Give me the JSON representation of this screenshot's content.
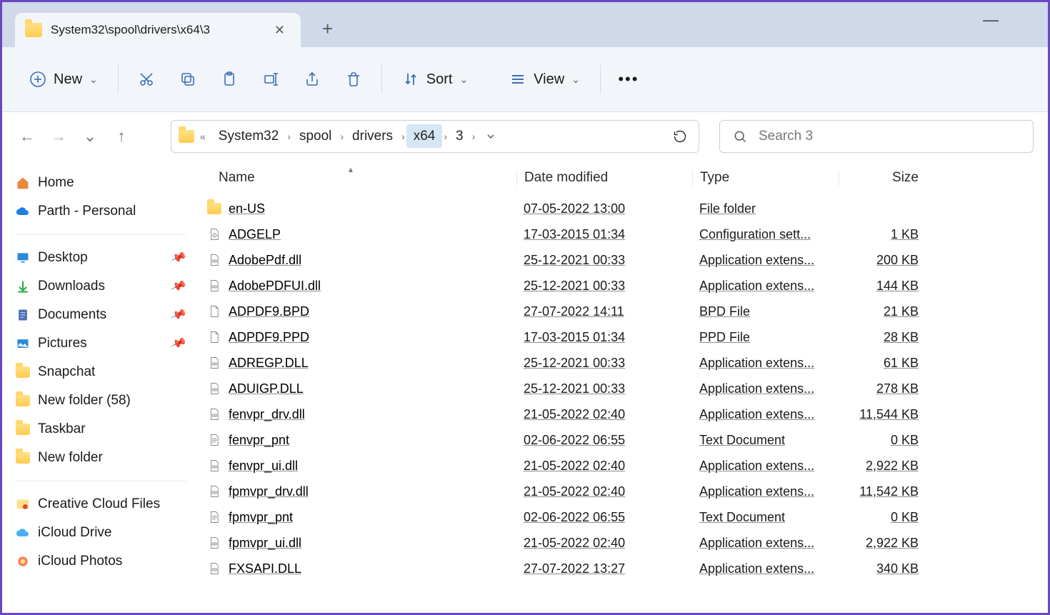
{
  "window": {
    "tab_title": "System32\\spool\\drivers\\x64\\3"
  },
  "toolbar": {
    "new_label": "New",
    "sort_label": "Sort",
    "view_label": "View"
  },
  "breadcrumb": {
    "items": [
      "System32",
      "spool",
      "drivers",
      "x64",
      "3"
    ],
    "selected_index": 3
  },
  "search": {
    "placeholder": "Search 3"
  },
  "sidebar": {
    "home": "Home",
    "personal": "Parth - Personal",
    "quick": [
      {
        "label": "Desktop",
        "pinned": true,
        "icon": "desktop"
      },
      {
        "label": "Downloads",
        "pinned": true,
        "icon": "down"
      },
      {
        "label": "Documents",
        "pinned": true,
        "icon": "doc"
      },
      {
        "label": "Pictures",
        "pinned": true,
        "icon": "pic"
      },
      {
        "label": "Snapchat",
        "pinned": false,
        "icon": "folder"
      },
      {
        "label": "New folder (58)",
        "pinned": false,
        "icon": "folder"
      },
      {
        "label": "Taskbar",
        "pinned": false,
        "icon": "folder"
      },
      {
        "label": "New folder",
        "pinned": false,
        "icon": "folder"
      }
    ],
    "extra": [
      {
        "label": "Creative Cloud Files",
        "icon": "cc"
      },
      {
        "label": "iCloud Drive",
        "icon": "icloud"
      },
      {
        "label": "iCloud Photos",
        "icon": "iphotos"
      }
    ]
  },
  "columns": {
    "name": "Name",
    "date": "Date modified",
    "type": "Type",
    "size": "Size"
  },
  "files": [
    {
      "icon": "folder",
      "name": "en-US",
      "date": "07-05-2022 13:00",
      "type": "File folder",
      "size": ""
    },
    {
      "icon": "ini",
      "name": "ADGELP",
      "date": "17-03-2015 01:34",
      "type": "Configuration sett...",
      "size": "1 KB"
    },
    {
      "icon": "dll",
      "name": "AdobePdf.dll",
      "date": "25-12-2021 00:33",
      "type": "Application extens...",
      "size": "200 KB"
    },
    {
      "icon": "dll",
      "name": "AdobePDFUI.dll",
      "date": "25-12-2021 00:33",
      "type": "Application extens...",
      "size": "144 KB"
    },
    {
      "icon": "file",
      "name": "ADPDF9.BPD",
      "date": "27-07-2022 14:11",
      "type": "BPD File",
      "size": "21 KB"
    },
    {
      "icon": "file",
      "name": "ADPDF9.PPD",
      "date": "17-03-2015 01:34",
      "type": "PPD File",
      "size": "28 KB"
    },
    {
      "icon": "dll",
      "name": "ADREGP.DLL",
      "date": "25-12-2021 00:33",
      "type": "Application extens...",
      "size": "61 KB"
    },
    {
      "icon": "dll",
      "name": "ADUIGP.DLL",
      "date": "25-12-2021 00:33",
      "type": "Application extens...",
      "size": "278 KB"
    },
    {
      "icon": "dll",
      "name": "fenvpr_drv.dll",
      "date": "21-05-2022 02:40",
      "type": "Application extens...",
      "size": "11,544 KB"
    },
    {
      "icon": "txt",
      "name": "fenvpr_pnt",
      "date": "02-06-2022 06:55",
      "type": "Text Document",
      "size": "0 KB"
    },
    {
      "icon": "dll",
      "name": "fenvpr_ui.dll",
      "date": "21-05-2022 02:40",
      "type": "Application extens...",
      "size": "2,922 KB"
    },
    {
      "icon": "dll",
      "name": "fpmvpr_drv.dll",
      "date": "21-05-2022 02:40",
      "type": "Application extens...",
      "size": "11,542 KB"
    },
    {
      "icon": "txt",
      "name": "fpmvpr_pnt",
      "date": "02-06-2022 06:55",
      "type": "Text Document",
      "size": "0 KB"
    },
    {
      "icon": "dll",
      "name": "fpmvpr_ui.dll",
      "date": "21-05-2022 02:40",
      "type": "Application extens...",
      "size": "2,922 KB"
    },
    {
      "icon": "dll",
      "name": "FXSAPI.DLL",
      "date": "27-07-2022 13:27",
      "type": "Application extens...",
      "size": "340 KB"
    }
  ]
}
